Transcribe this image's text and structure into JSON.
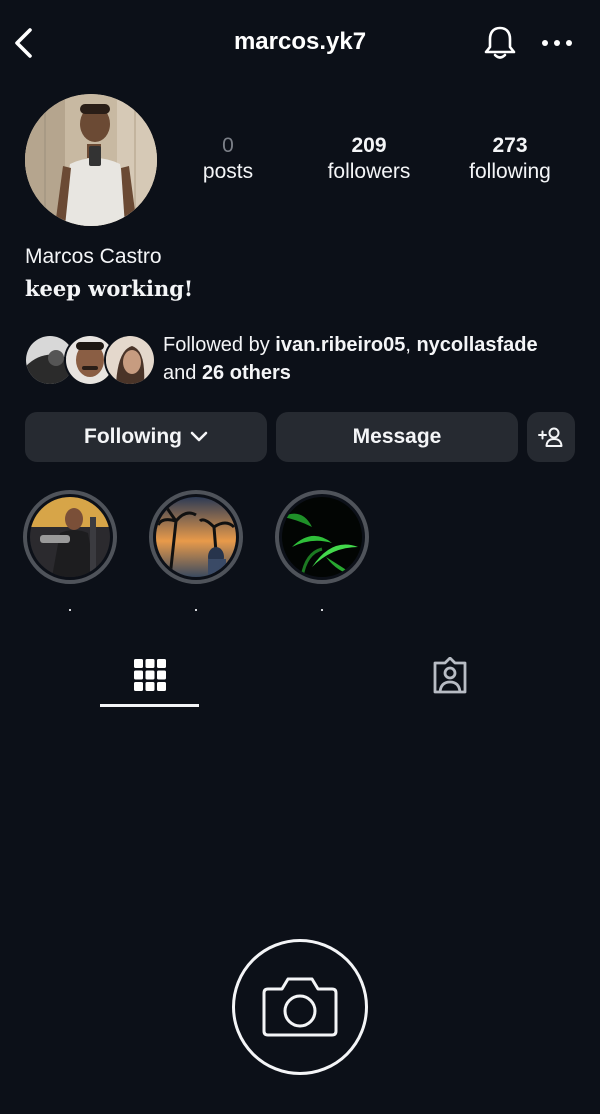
{
  "header": {
    "username": "marcos.yk7",
    "back_icon": "chevron-left-icon",
    "bell_icon": "bell-icon",
    "more_icon": "more-horizontal-icon"
  },
  "profile": {
    "name": "Marcos Castro",
    "bio": "keep working!",
    "stats": {
      "posts": {
        "value": "0",
        "label": "posts"
      },
      "followers": {
        "value": "209",
        "label": "followers"
      },
      "following": {
        "value": "273",
        "label": "following"
      }
    }
  },
  "followed_by": {
    "prefix": "Followed by ",
    "user1": "ivan.ribeiro05",
    "sep": ", ",
    "user2": "nycollasfade",
    "and": "and ",
    "others": "26 others"
  },
  "buttons": {
    "following": "Following",
    "message": "Message",
    "add_user_icon": "add-user-icon"
  },
  "highlights": [
    {
      "label": "."
    },
    {
      "label": "."
    },
    {
      "label": "."
    }
  ],
  "tabs": [
    {
      "icon": "grid-icon",
      "active": true
    },
    {
      "icon": "tagged-icon",
      "active": false
    }
  ],
  "colors": {
    "background": "#0c1018",
    "button": "#262a31",
    "muted": "#7b7f87",
    "ring": "#4f535a"
  }
}
